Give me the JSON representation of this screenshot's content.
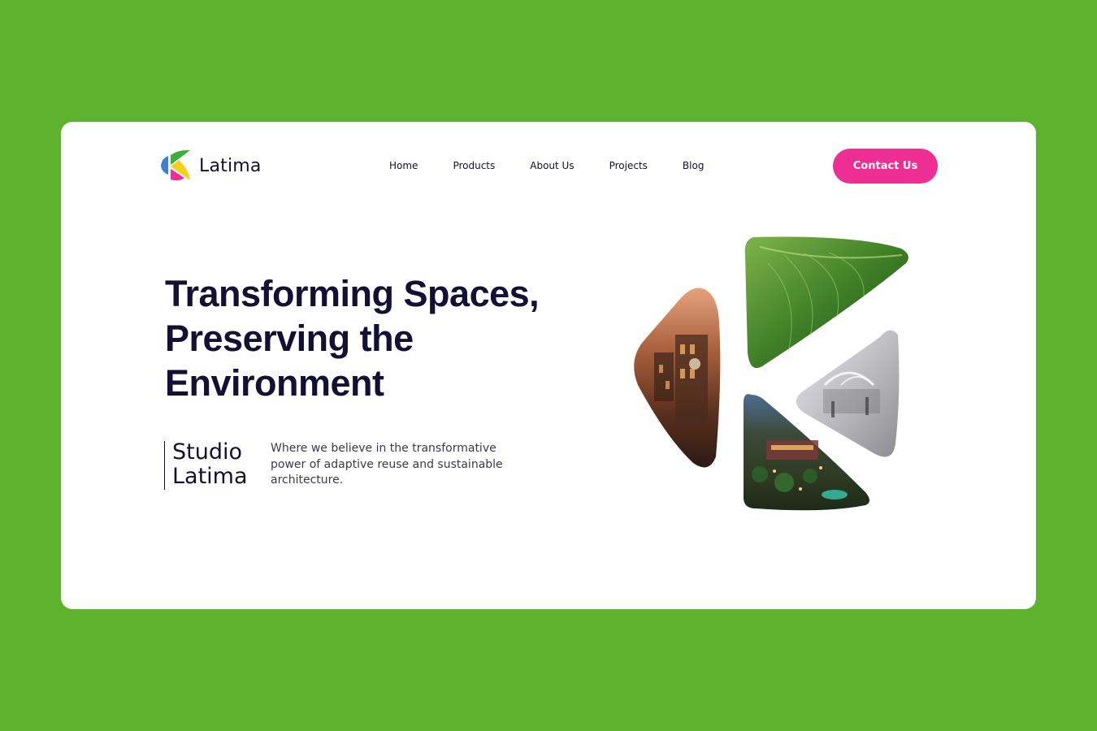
{
  "brand": {
    "name": "Latima",
    "colors": {
      "background": "#5db22e",
      "accent": "#ee2e93",
      "text": "#141033",
      "logo_blue": "#3d7fd6",
      "logo_green": "#3fae3a",
      "logo_yellow": "#f6d21e",
      "logo_pink": "#ee2e93"
    }
  },
  "nav": {
    "items": [
      "Home",
      "Products",
      "About Us",
      "Projects",
      "Blog"
    ]
  },
  "contact_button": "Contact Us",
  "hero": {
    "title": "Transforming Spaces, Preserving the Environment",
    "studio_name": "Studio Latima",
    "tagline": "Where we believe in the transformative power of adaptive reuse and sustainable architecture."
  },
  "collage": {
    "images": [
      "building-photo",
      "leaf-photo",
      "interior-photo",
      "resort-photo"
    ]
  }
}
